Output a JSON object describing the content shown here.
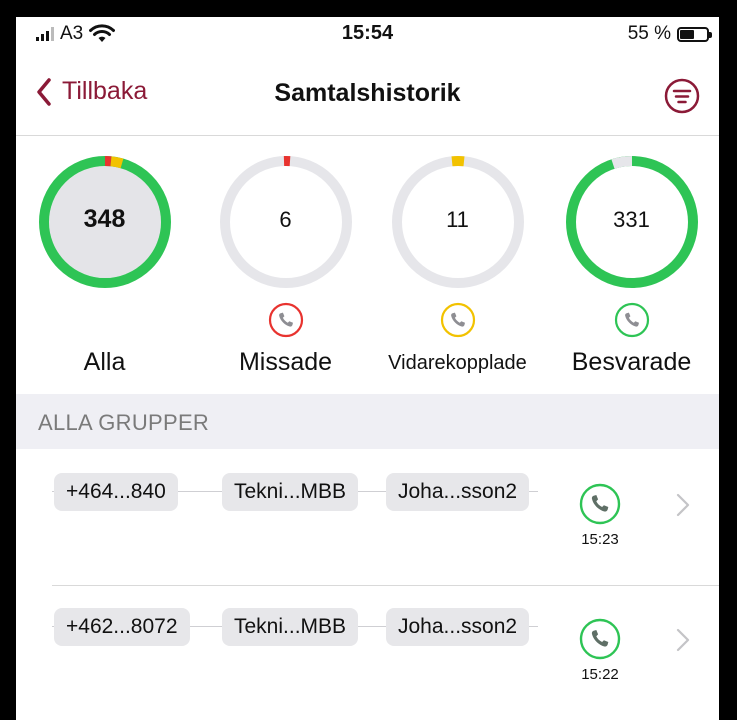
{
  "status_bar": {
    "carrier": "A3",
    "time": "15:54",
    "battery": "55 %",
    "battery_level": 0.55
  },
  "nav": {
    "back_label": "Tillbaka",
    "title": "Samtalshistorik"
  },
  "stats": [
    {
      "value": "348",
      "label": "Alla"
    },
    {
      "value": "6",
      "label": "Missade",
      "icon": "phone-icon",
      "color": "#e8332f"
    },
    {
      "value": "11",
      "label": "Vidarekopplade",
      "icon": "phone-icon",
      "color": "#f2c200"
    },
    {
      "value": "331",
      "label": "Besvarade",
      "icon": "phone-icon",
      "color": "#2ec455"
    }
  ],
  "section": {
    "title": "ALLA GRUPPER"
  },
  "calls": [
    {
      "chips": [
        "+464...840",
        "Tekni...MBB",
        "Joha...sson2"
      ],
      "time": "15:23",
      "status_color": "#2ec455"
    },
    {
      "chips": [
        "+462...8072",
        "Tekni...MBB",
        "Joha...sson2"
      ],
      "time": "15:22",
      "status_color": "#2ec455"
    }
  ],
  "colors": {
    "accent": "#8b1a37",
    "missed": "#e8332f",
    "forwarded": "#f2c200",
    "answered": "#2ec455",
    "ring_track": "#e6e6ea"
  }
}
